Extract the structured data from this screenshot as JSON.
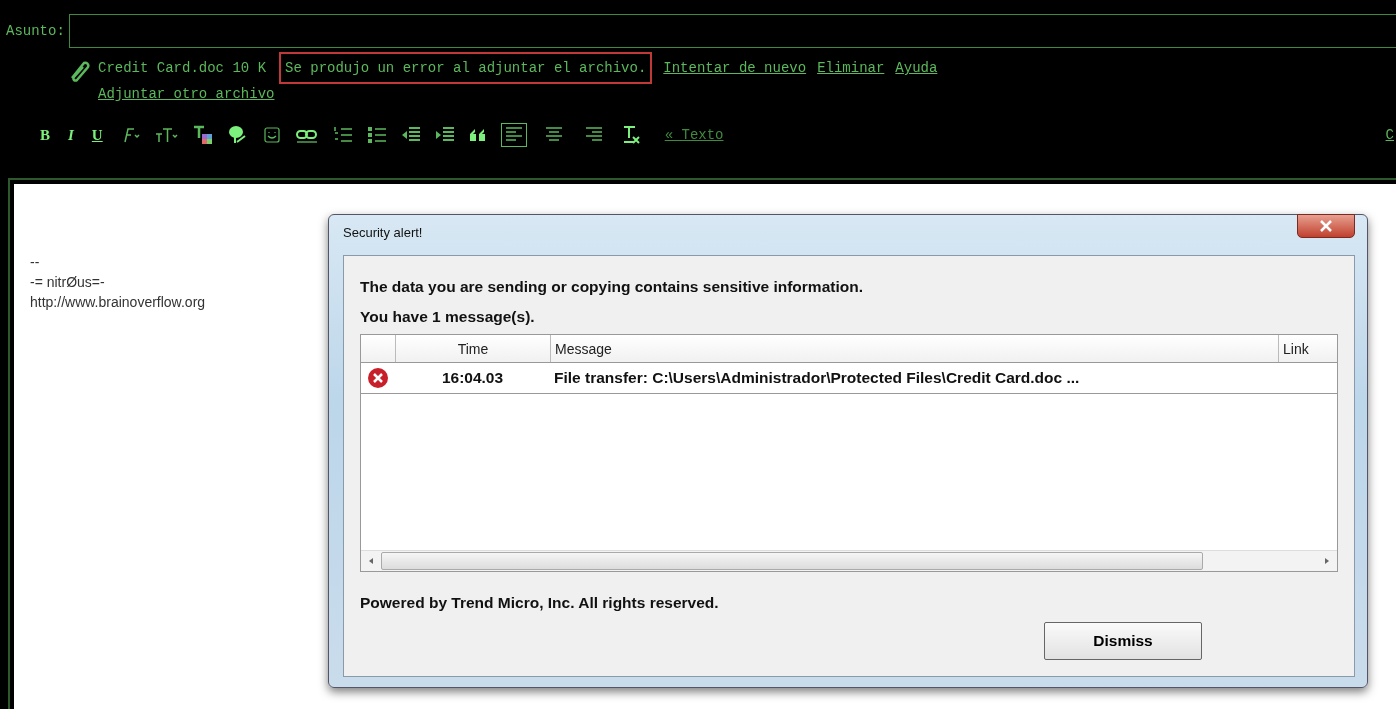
{
  "subject": {
    "label": "Asunto:"
  },
  "attachment": {
    "file": "Credit Card.doc 10 K",
    "error": "Se produjo un error al adjuntar el archivo.",
    "actions": [
      "Intentar de nuevo",
      "Eliminar",
      "Ayuda"
    ],
    "add_another": "Adjuntar otro archivo"
  },
  "toolbar": {
    "format_buttons": [
      "B",
      "I",
      "U"
    ],
    "align_buttons": [
      {
        "selected": true
      },
      {
        "selected": false
      },
      {
        "selected": false
      }
    ],
    "text_link": "« Texto",
    "cut_link": "C"
  },
  "signature": [
    "--",
    "-= nitrØus=-",
    "http://www.brainoverflow.org"
  ],
  "dialog": {
    "title": "Security alert!",
    "lines": [
      "The data you are sending or copying contains sensitive information.",
      "You have 1 message(s)."
    ],
    "table": {
      "columns": [
        "Time",
        "Message",
        "Link"
      ],
      "rows": [
        {
          "kind": "error",
          "time": "16:04.03",
          "message": "File transfer: C:\\Users\\Administrador\\Protected Files\\Credit Card.doc ..."
        }
      ]
    },
    "footer": "Powered by Trend Micro, Inc. All rights reserved.",
    "button": "Dismiss"
  }
}
